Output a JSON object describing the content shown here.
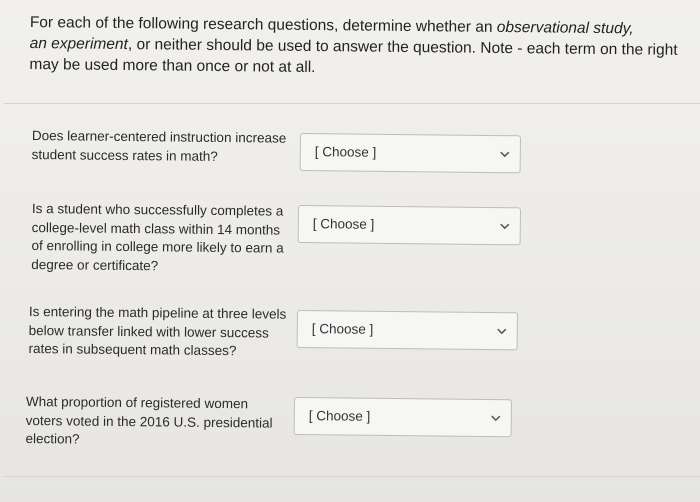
{
  "prompt": {
    "line1": "For each of the following research questions, determine whether an ",
    "line1_em": "observational study,",
    "line2_em": "an experiment",
    "line2": ", or neither should be used to answer the question. Note - each term on the right",
    "line3": "may be used more than once or not at all."
  },
  "questions": [
    {
      "text_lines": [
        "Does learner-centered instruction increase",
        "student success rates in math?"
      ],
      "select_value": "[ Choose ]"
    },
    {
      "text_lines": [
        "Is a student who successfully completes a",
        "college-level math class within 14 months",
        "of enrolling in college more likely to earn a",
        "degree or certificate?"
      ],
      "select_value": "[ Choose ]"
    },
    {
      "text_lines": [
        "Is entering the math pipeline at three levels",
        "below transfer linked with lower success",
        "rates in subsequent math classes?"
      ],
      "select_value": "[ Choose ]"
    },
    {
      "text_lines": [
        "What proportion of registered women",
        "voters voted in the 2016 U.S. presidential",
        "election?"
      ],
      "select_value": "[ Choose ]"
    }
  ],
  "icons": {
    "dropdown": "chevron-down-icon"
  }
}
